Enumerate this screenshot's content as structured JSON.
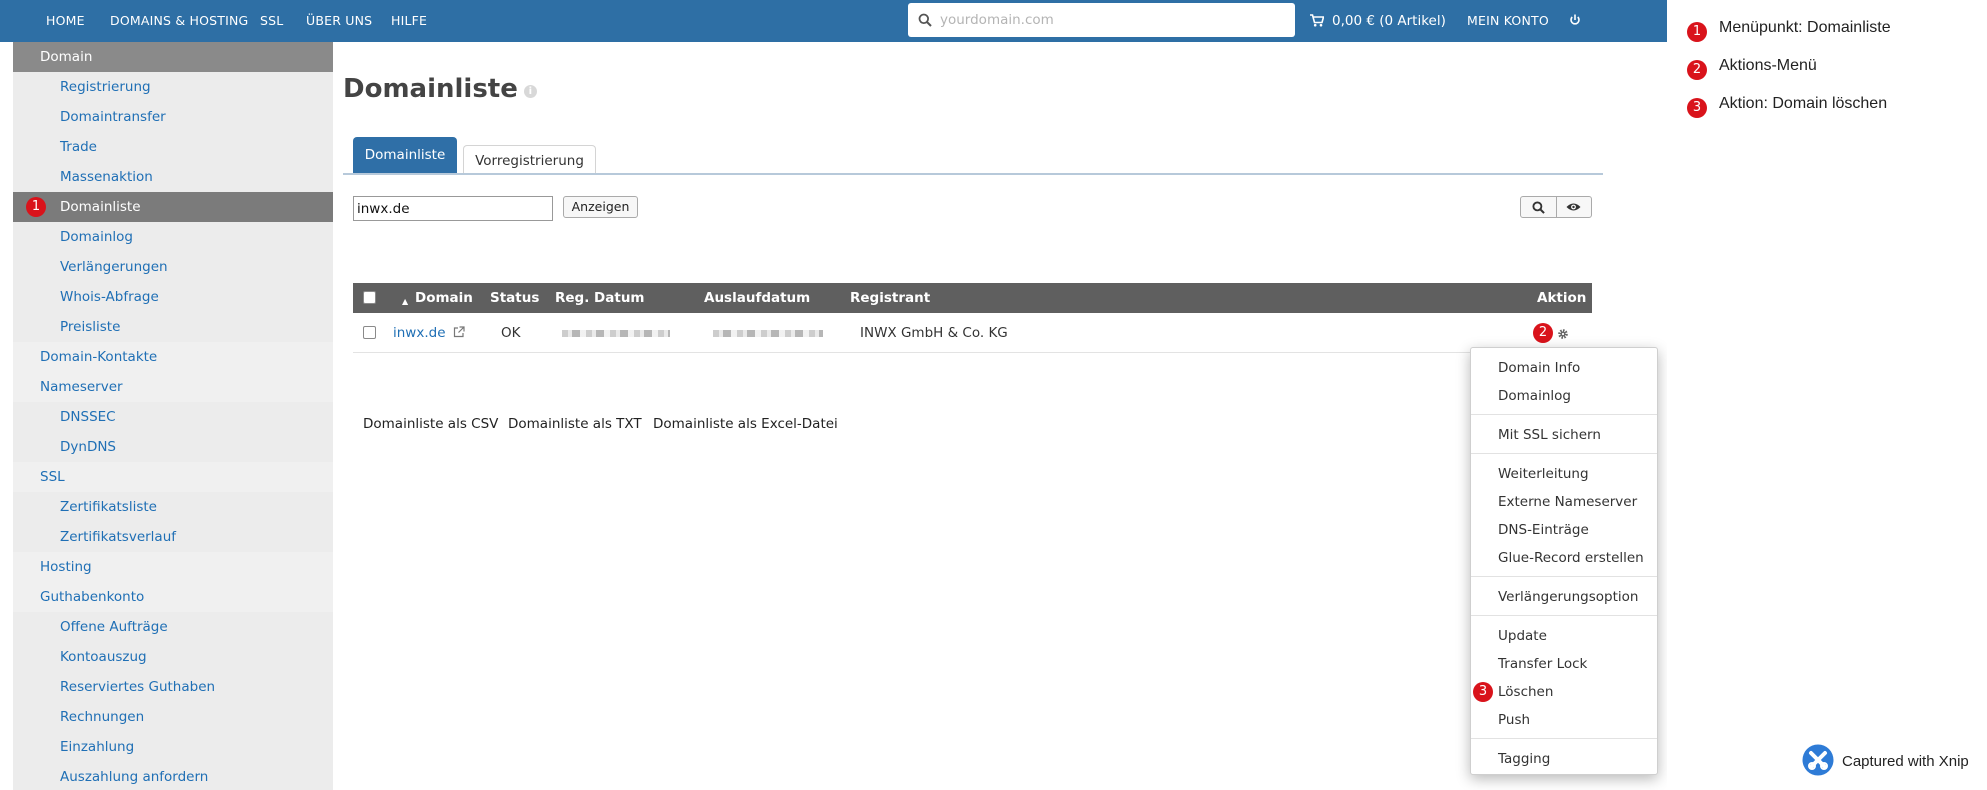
{
  "topnav": {
    "items": [
      "HOME",
      "DOMAINS & HOSTING",
      "SSL",
      "ÜBER UNS",
      "HILFE"
    ],
    "search_placeholder": "yourdomain.com",
    "cart_label": "0,00 € (0 Artikel)",
    "account_label": "MEIN KONTO"
  },
  "sidebar": {
    "section_header": "Domain",
    "items": [
      {
        "label": "Registrierung"
      },
      {
        "label": "Domaintransfer"
      },
      {
        "label": "Trade"
      },
      {
        "label": "Massenaktion"
      },
      {
        "label": "Domainliste",
        "marker": "1"
      },
      {
        "label": "Domainlog"
      },
      {
        "label": "Verlängerungen"
      },
      {
        "label": "Whois-Abfrage"
      },
      {
        "label": "Preisliste"
      },
      {
        "label": "Domain-Kontakte"
      },
      {
        "label": "Nameserver"
      },
      {
        "label": "DNSSEC"
      },
      {
        "label": "DynDNS"
      },
      {
        "label": "SSL"
      },
      {
        "label": "Zertifikatsliste"
      },
      {
        "label": "Zertifikatsverlauf"
      },
      {
        "label": "Hosting"
      },
      {
        "label": "Guthabenkonto"
      },
      {
        "label": "Offene Aufträge"
      },
      {
        "label": "Kontoauszug"
      },
      {
        "label": "Reserviertes Guthaben"
      },
      {
        "label": "Rechnungen"
      },
      {
        "label": "Einzahlung"
      },
      {
        "label": "Auszahlung anfordern"
      }
    ]
  },
  "main": {
    "title": "Domainliste",
    "tabs": [
      "Domainliste",
      "Vorregistrierung"
    ],
    "filter_value": "inwx.de",
    "show_button": "Anzeigen",
    "table": {
      "headers": [
        "Domain",
        "Status",
        "Reg. Datum",
        "Auslaufdatum",
        "Registrant",
        "Aktion"
      ],
      "row": {
        "domain": "inwx.de",
        "status": "OK",
        "registrant": "INWX GmbH & Co. KG",
        "action_marker": "2"
      }
    },
    "exports": [
      "Domainliste als CSV",
      "Domainliste als TXT",
      "Domainliste als Excel-Datei"
    ]
  },
  "action_menu": {
    "groups": [
      [
        "Domain Info",
        "Domainlog"
      ],
      [
        "Mit SSL sichern"
      ],
      [
        "Weiterleitung",
        "Externe Nameserver",
        "DNS-Einträge",
        "Glue-Record erstellen"
      ],
      [
        "Verlängerungsoption"
      ],
      [
        "Update",
        "Transfer Lock",
        "Löschen",
        "Push"
      ],
      [
        "Tagging"
      ]
    ],
    "delete_marker": "3"
  },
  "legend": [
    {
      "number": "1",
      "text": "Menüpunkt: Domainliste"
    },
    {
      "number": "2",
      "text": "Aktions-Menü"
    },
    {
      "number": "3",
      "text": "Aktion: Domain löschen"
    }
  ],
  "watermark": "Captured with Xnip",
  "colors": {
    "nav_blue": "#2e6fa5",
    "marker_red": "#d9131b",
    "link_blue": "#1f6fb5",
    "table_header": "#5f5f5f"
  }
}
